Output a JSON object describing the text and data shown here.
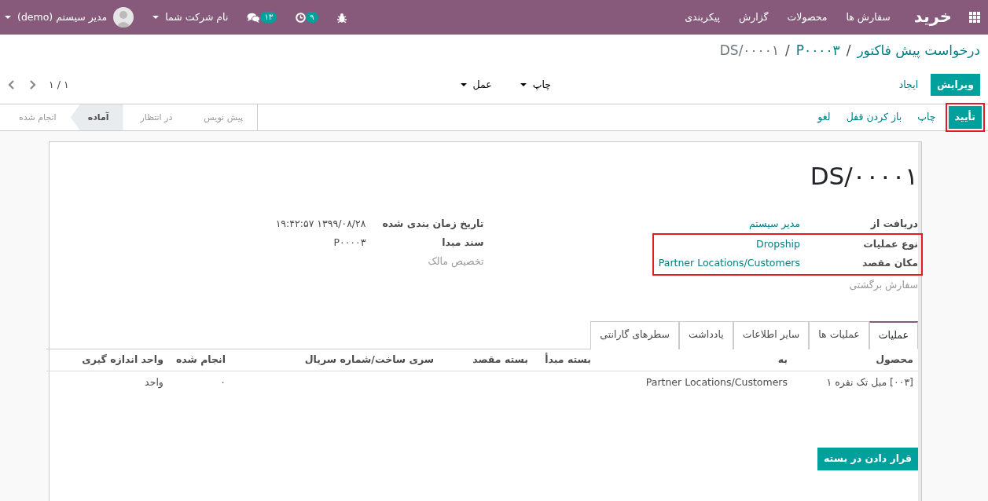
{
  "navbar": {
    "brand": "خرید",
    "menus": [
      "سفارش ها",
      "محصولات",
      "گزارش",
      "پیکربندی"
    ],
    "activity_count": "۹",
    "message_count": "۱۳",
    "company": "نام شرکت شما",
    "user": "مدیر سیستم (demo)"
  },
  "breadcrumbs": [
    {
      "label": "درخواست پیش فاکتور",
      "link": true
    },
    {
      "separator_before": "/",
      "label": "P۰۰۰۰۳",
      "link": true
    },
    {
      "separator_before": "/",
      "label": "DS/۰۰۰۰۱",
      "link": false
    }
  ],
  "actions": {
    "primary": "ویرایش",
    "secondary": "ایجاد"
  },
  "dropdowns": [
    "چاپ",
    "عمل"
  ],
  "pager": "۱ / ۱",
  "statusbar_buttons": [
    {
      "label": "تأیید",
      "kind": "primary",
      "highlighted": true
    },
    {
      "label": "چاپ",
      "kind": "link",
      "highlighted": false
    },
    {
      "label": "باز کردن قفل",
      "kind": "link",
      "highlighted": false
    },
    {
      "label": "لغو",
      "kind": "link",
      "highlighted": false
    }
  ],
  "stages": [
    {
      "label": "پیش نویس",
      "selected": false
    },
    {
      "label": "در انتظار",
      "selected": false
    },
    {
      "label": "آماده",
      "selected": true
    },
    {
      "label": "انجام شده",
      "selected": false
    }
  ],
  "record_title": "DS/۰۰۰۰۱",
  "field_groups": [
    [
      {
        "label": "دریافت از",
        "value": "مدیر سیستم",
        "kind": "link",
        "highlighted": false
      },
      {
        "label": "نوع عملیات",
        "value": "Dropship",
        "kind": "link",
        "highlighted": true
      },
      {
        "label": "مکان مقصد",
        "value": "Partner Locations/Customers",
        "kind": "link",
        "highlighted": true
      },
      {
        "label": "سفارش برگشتی",
        "kind": "empty",
        "highlighted": false
      }
    ],
    [
      {
        "label": "تاریخ زمان بندی شده",
        "value": "۱۳۹۹/۰۸/۲۸ ۱۹:۴۲:۵۷",
        "kind": "text",
        "highlighted": false
      },
      {
        "label": "سند مبدا",
        "value": "P۰۰۰۰۳",
        "kind": "text",
        "highlighted": false
      },
      {
        "label": "تخصیص مالک",
        "kind": "empty",
        "highlighted": false
      }
    ]
  ],
  "tabs": [
    {
      "label": "عملیات",
      "selected": true
    },
    {
      "label": "عملیات ها",
      "selected": false
    },
    {
      "label": "سایر اطلاعات",
      "selected": false
    },
    {
      "label": "یادداشت",
      "selected": false
    },
    {
      "label": "سطرهای گارانتی",
      "selected": false
    }
  ],
  "table": {
    "columns": [
      "محصول",
      "به",
      "بسته مبدأ",
      "بسته مقصد",
      "سری ساخت/شماره سریال",
      "انجام شده",
      "واحد اندازه گیری"
    ],
    "rows": [
      [
        "[۰۰۳] مبل تک نفره ۱",
        "Partner Locations/Customers",
        "",
        "",
        "",
        "۰",
        "واحد"
      ]
    ]
  },
  "put_in_pack_button": "قرار دادن در بسته"
}
